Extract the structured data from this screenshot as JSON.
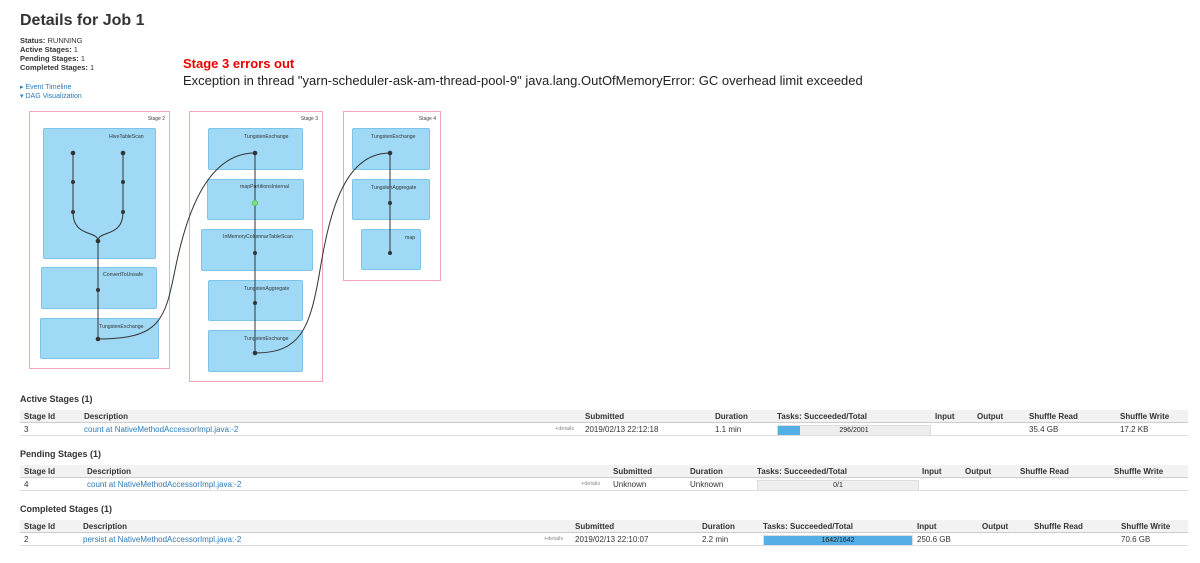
{
  "page": {
    "title": "Details for Job 1"
  },
  "summary": {
    "status_label": "Status:",
    "status_value": "RUNNING",
    "active_label": "Active Stages:",
    "active_value": "1",
    "pending_label": "Pending Stages:",
    "pending_value": "1",
    "completed_label": "Completed Stages:",
    "completed_value": "1"
  },
  "annotation": {
    "title": "Stage 3 errors out",
    "message": "Exception in thread \"yarn-scheduler-ask-am-thread-pool-9\" java.lang.OutOfMemoryError: GC overhead limit exceeded"
  },
  "controls": {
    "event_timeline": "Event Timeline",
    "dag_visualization": "DAG Visualization"
  },
  "dag": {
    "stage2": {
      "label": "Stage 2",
      "nodes": [
        "HiveTableScan",
        "ConvertToUnsafe",
        "TungstenExchange"
      ]
    },
    "stage3": {
      "label": "Stage 3",
      "nodes": [
        "TungstenExchange",
        "mapPartitionsInternal",
        "InMemoryColumnarTableScan",
        "TungstenAggregate",
        "TungstenExchange"
      ]
    },
    "stage4": {
      "label": "Stage 4",
      "nodes": [
        "TungstenExchange",
        "TungstenAggregate",
        "map"
      ]
    }
  },
  "headers": {
    "stage_id": "Stage Id",
    "description": "Description",
    "submitted": "Submitted",
    "duration": "Duration",
    "tasks": "Tasks: Succeeded/Total",
    "input": "Input",
    "output": "Output",
    "shuffle_read": "Shuffle Read",
    "shuffle_write": "Shuffle Write"
  },
  "details_link": "+details",
  "active": {
    "title": "Active Stages (1)",
    "row": {
      "id": "3",
      "description": "count at NativeMethodAccessorImpl.java:-2",
      "submitted": "2019/02/13 22:12:18",
      "duration": "1.1 min",
      "tasks": "296/2001",
      "tasks_fraction": 0.148,
      "input": "",
      "output": "",
      "shuffle_read": "35.4 GB",
      "shuffle_write": "17.2 KB"
    }
  },
  "pending": {
    "title": "Pending Stages (1)",
    "row": {
      "id": "4",
      "description": "count at NativeMethodAccessorImpl.java:-2",
      "submitted": "Unknown",
      "duration": "Unknown",
      "tasks": "0/1",
      "tasks_fraction": 0,
      "input": "",
      "output": "",
      "shuffle_read": "",
      "shuffle_write": ""
    }
  },
  "completed": {
    "title": "Completed Stages (1)",
    "row": {
      "id": "2",
      "description": "persist at NativeMethodAccessorImpl.java:-2",
      "submitted": "2019/02/13 22:10:07",
      "duration": "2.2 min",
      "tasks": "1642/1642",
      "tasks_fraction": 1.0,
      "input": "250.6 GB",
      "output": "",
      "shuffle_read": "",
      "shuffle_write": "70.6 GB"
    }
  }
}
